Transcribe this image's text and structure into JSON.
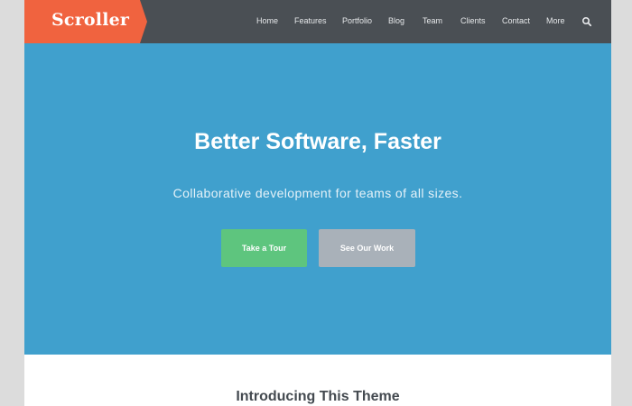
{
  "header": {
    "logo_text": "Scroller",
    "nav": [
      {
        "label": "Home"
      },
      {
        "label": "Features"
      },
      {
        "label": "Portfolio"
      },
      {
        "label": "Blog"
      },
      {
        "label": "Team"
      },
      {
        "label": "Clients"
      },
      {
        "label": "Contact"
      },
      {
        "label": "More"
      }
    ],
    "search_icon": "search-icon"
  },
  "hero": {
    "title": "Better Software, Faster",
    "subtitle": "Collaborative development for teams of all sizes.",
    "primary_button": "Take a Tour",
    "secondary_button": "See Our Work"
  },
  "intro": {
    "title": "Introducing This Theme"
  },
  "colors": {
    "brand_orange": "#f0633f",
    "header_bg": "#4a4f54",
    "hero_bg": "#40a0cd",
    "primary_green": "#5ec57e",
    "secondary_gray": "#a9b1b9"
  }
}
